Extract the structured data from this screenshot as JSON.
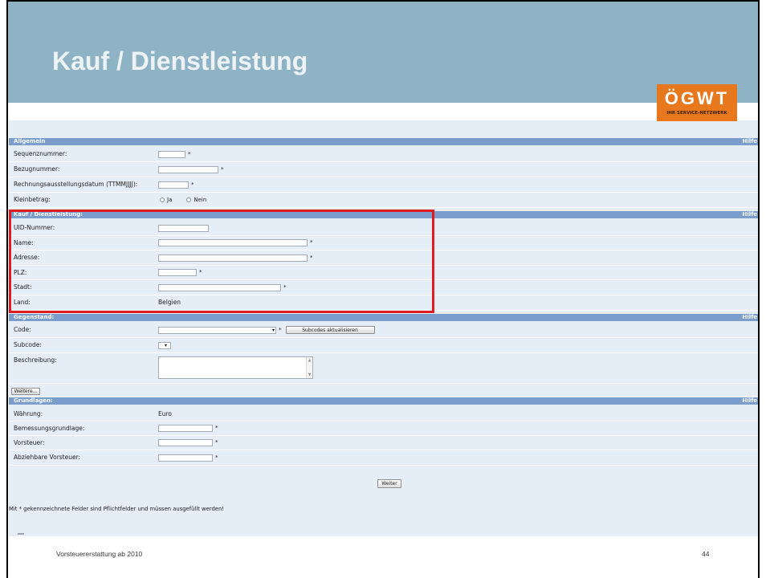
{
  "slide": {
    "title": "Kauf / Dienstleistung",
    "footer_text": "Vorsteuererstattung ab 2010",
    "page_number": "44"
  },
  "logo": {
    "wordmark": "ÖGWT",
    "tagline": "IHR SERVICE-NETZWERK"
  },
  "colors": {
    "header_band": "#8db3c5",
    "logo_orange": "#e8781e",
    "section_bar": "#7b9dcc",
    "form_background": "#e5edf7",
    "highlight_red": "#e11b22"
  },
  "icons": {
    "radio": "radio-button-icon",
    "select_arrow": "chevron-down-icon",
    "scroll_up": "scroll-up-arrow-icon",
    "scroll_down": "scroll-down-arrow-icon"
  },
  "form": {
    "help_label": "Hilfe",
    "required_mark": "*",
    "allgemein": {
      "title": "Allgemein",
      "sequenznummer": {
        "label": "Sequenznummer:",
        "value": ""
      },
      "bezugnummer": {
        "label": "Bezugnummer:",
        "value": ""
      },
      "rechnungsausstellungsdatum": {
        "label": "Rechnungsausstellungsdatum (TTMMJJJJ):",
        "value": ""
      },
      "kleinbetrag": {
        "label": "Kleinbetrag:",
        "options": [
          "Ja",
          "Nein"
        ]
      }
    },
    "kauf_dienstleistung": {
      "title": "Kauf / Dienstleistung:",
      "uid_nummer": {
        "label": "UID-Nummer:",
        "value": ""
      },
      "name": {
        "label": "Name:",
        "value": ""
      },
      "adresse": {
        "label": "Adresse:",
        "value": ""
      },
      "plz": {
        "label": "PLZ:",
        "value": ""
      },
      "stadt": {
        "label": "Stadt:",
        "value": ""
      },
      "land": {
        "label": "Land:",
        "value": "Belgien"
      }
    },
    "gegenstand": {
      "title": "Gegenstand:",
      "code": {
        "label": "Code:",
        "value": ""
      },
      "subcodes_button_label": "Subcodes aktualisieren",
      "subcode": {
        "label": "Subcode:",
        "value": ""
      },
      "beschreibung": {
        "label": "Beschreibung:",
        "value": ""
      },
      "weitere_button_label": "Weitere..."
    },
    "grundlagen": {
      "title": "Grundlagen:",
      "waehrung": {
        "label": "Währung:",
        "value": "Euro"
      },
      "bemessungsgrundlage": {
        "label": "Bemessungsgrundlage:",
        "value": ""
      },
      "vorsteuer": {
        "label": "Vorsteuer:",
        "value": ""
      },
      "abziehbare_vorsteuer": {
        "label": "Abziehbare Vorsteuer:",
        "value": ""
      }
    },
    "weiter_button_label": "Weiter",
    "required_note": "Mit * gekennzeichnete Felder sind Pflichtfelder und müssen ausgefüllt werden!"
  }
}
